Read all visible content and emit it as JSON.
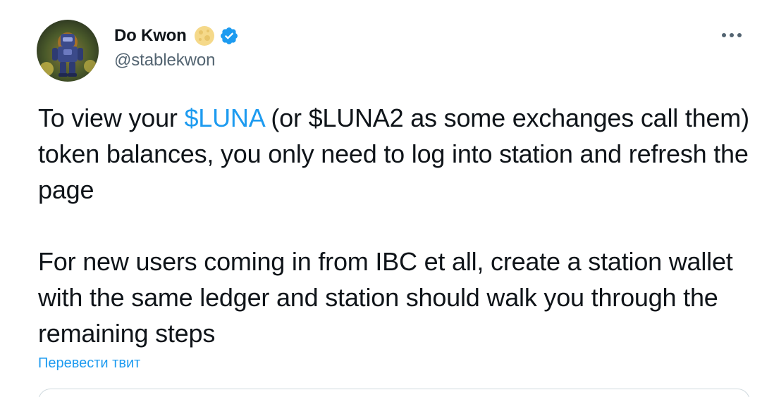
{
  "author": {
    "display_name": "Do Kwon",
    "handle": "@stablekwon",
    "name_emoji_icon": "full-moon-icon",
    "verified_icon": "verified-badge-icon",
    "avatar_icon": "robot-avatar-icon"
  },
  "menu": {
    "icon": "more-options-icon"
  },
  "tweet": {
    "p1_before": "To view your ",
    "p1_cashtag": "$LUNA",
    "p1_after": " (or $LUNA2 as some exchanges call them) token balances, you only need to log into station and refresh the page",
    "p2": "For new users coming in from IBC et all, create a station wallet with the same ledger and station should walk you through the remaining steps"
  },
  "translate_label": "Перевести твит",
  "colors": {
    "accent": "#1d9bf0",
    "text": "#0f1419",
    "secondary": "#536471",
    "border": "#cfd9de"
  }
}
